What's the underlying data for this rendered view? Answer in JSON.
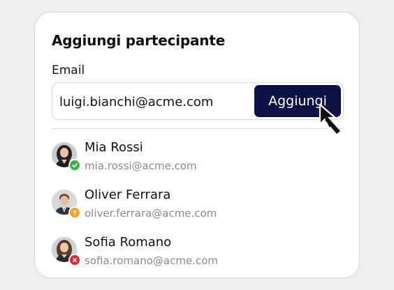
{
  "dialog": {
    "title": "Aggiungi partecipante",
    "email_label": "Email",
    "email_value": "luigi.bianchi@acme.com",
    "add_button_label": "Aggiungi"
  },
  "members": [
    {
      "name": "Mia Rossi",
      "email": "mia.rossi@acme.com",
      "status": "confirmed",
      "status_icon": "check-icon",
      "status_color": "#3cb043"
    },
    {
      "name": "Oliver Ferrara",
      "email": "oliver.ferrara@acme.com",
      "status": "pending",
      "status_icon": "question-icon",
      "status_color": "#f5a623"
    },
    {
      "name": "Sofia Romano",
      "email": "sofia.romano@acme.com",
      "status": "declined",
      "status_icon": "x-icon",
      "status_color": "#e5252a"
    }
  ],
  "colors": {
    "button_bg": "#0d1144",
    "card_bg": "#ffffff",
    "page_bg": "#efeeec"
  }
}
